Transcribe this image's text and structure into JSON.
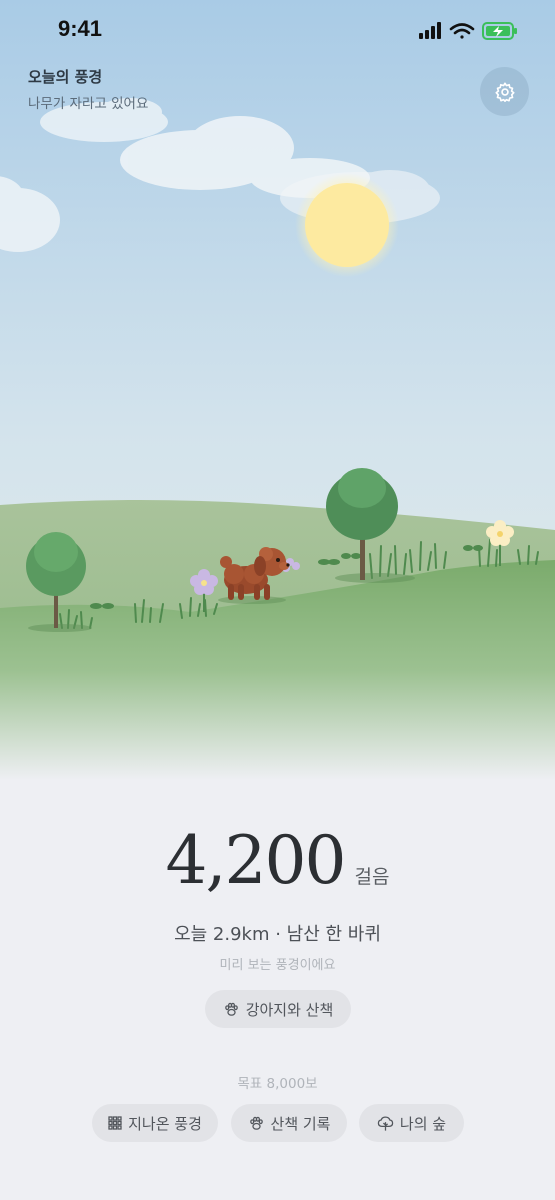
{
  "status_bar": {
    "time": "9:41"
  },
  "header": {
    "title": "오늘의 풍경",
    "subtitle": "나무가 자라고 있어요"
  },
  "stats": {
    "steps": "4,200",
    "steps_unit": "걸음",
    "summary": "오늘 2.9km · 남산 한 바퀴",
    "preview_note": "미리 보는 풍경이에요"
  },
  "walk_button": {
    "label": "강아지와 산책",
    "icon": "paw-icon"
  },
  "goal": {
    "label": "목표 8,000보"
  },
  "bottom_nav": [
    {
      "label": "지나온 풍경",
      "icon": "grid-icon"
    },
    {
      "label": "산책 기록",
      "icon": "paw-icon"
    },
    {
      "label": "나의 숲",
      "icon": "tree-icon"
    }
  ],
  "colors": {
    "sky_top": "#a9cbe6",
    "sky_bottom": "#e6ede9",
    "sun": "#fdeaa0",
    "hill": "#78a86a",
    "tree": "#4f8e58",
    "dog": "#9a4a2c",
    "page_bg": "#eeeff3"
  }
}
